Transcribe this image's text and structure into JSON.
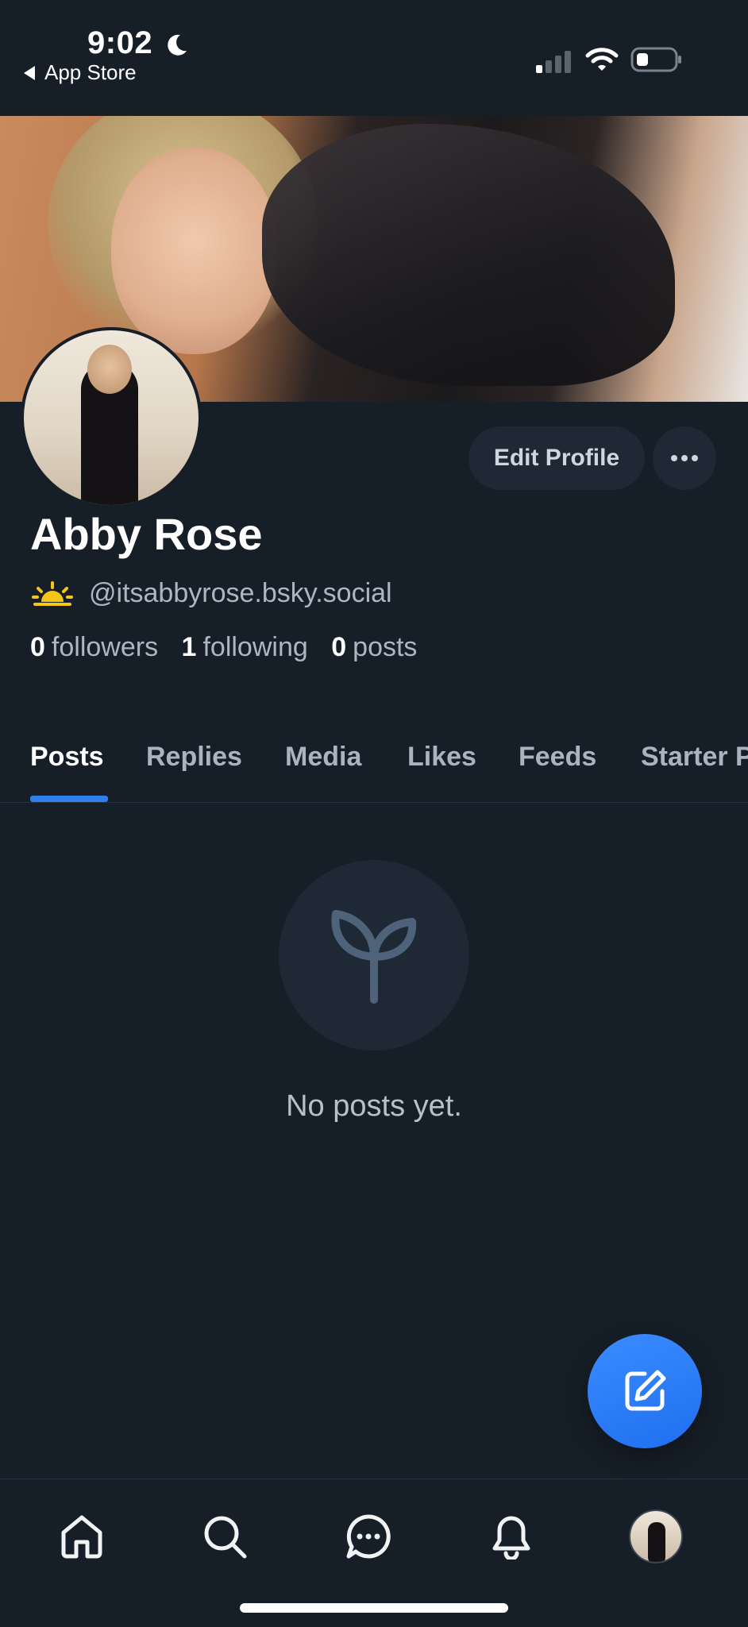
{
  "status_bar": {
    "time": "9:02",
    "back_label": "App Store"
  },
  "profile": {
    "display_name": "Abby Rose",
    "handle": "@itsabbyrose.bsky.social",
    "edit_profile_label": "Edit Profile",
    "stats": {
      "followers_count": "0",
      "followers_label": "followers",
      "following_count": "1",
      "following_label": "following",
      "posts_count": "0",
      "posts_label": "posts"
    }
  },
  "tabs": [
    {
      "label": "Posts",
      "active": true
    },
    {
      "label": "Replies",
      "active": false
    },
    {
      "label": "Media",
      "active": false
    },
    {
      "label": "Likes",
      "active": false
    },
    {
      "label": "Feeds",
      "active": false
    },
    {
      "label": "Starter Packs",
      "active": false
    }
  ],
  "empty_state": {
    "icon": "sprout-icon",
    "message": "No posts yet."
  },
  "bottom_nav": [
    {
      "icon": "home-icon"
    },
    {
      "icon": "search-icon"
    },
    {
      "icon": "chat-icon"
    },
    {
      "icon": "bell-icon"
    },
    {
      "icon": "profile-avatar"
    }
  ],
  "colors": {
    "background": "#161e27",
    "accent": "#2f80ed",
    "muted_text": "#aeb6c1",
    "surface": "#1e2935"
  }
}
